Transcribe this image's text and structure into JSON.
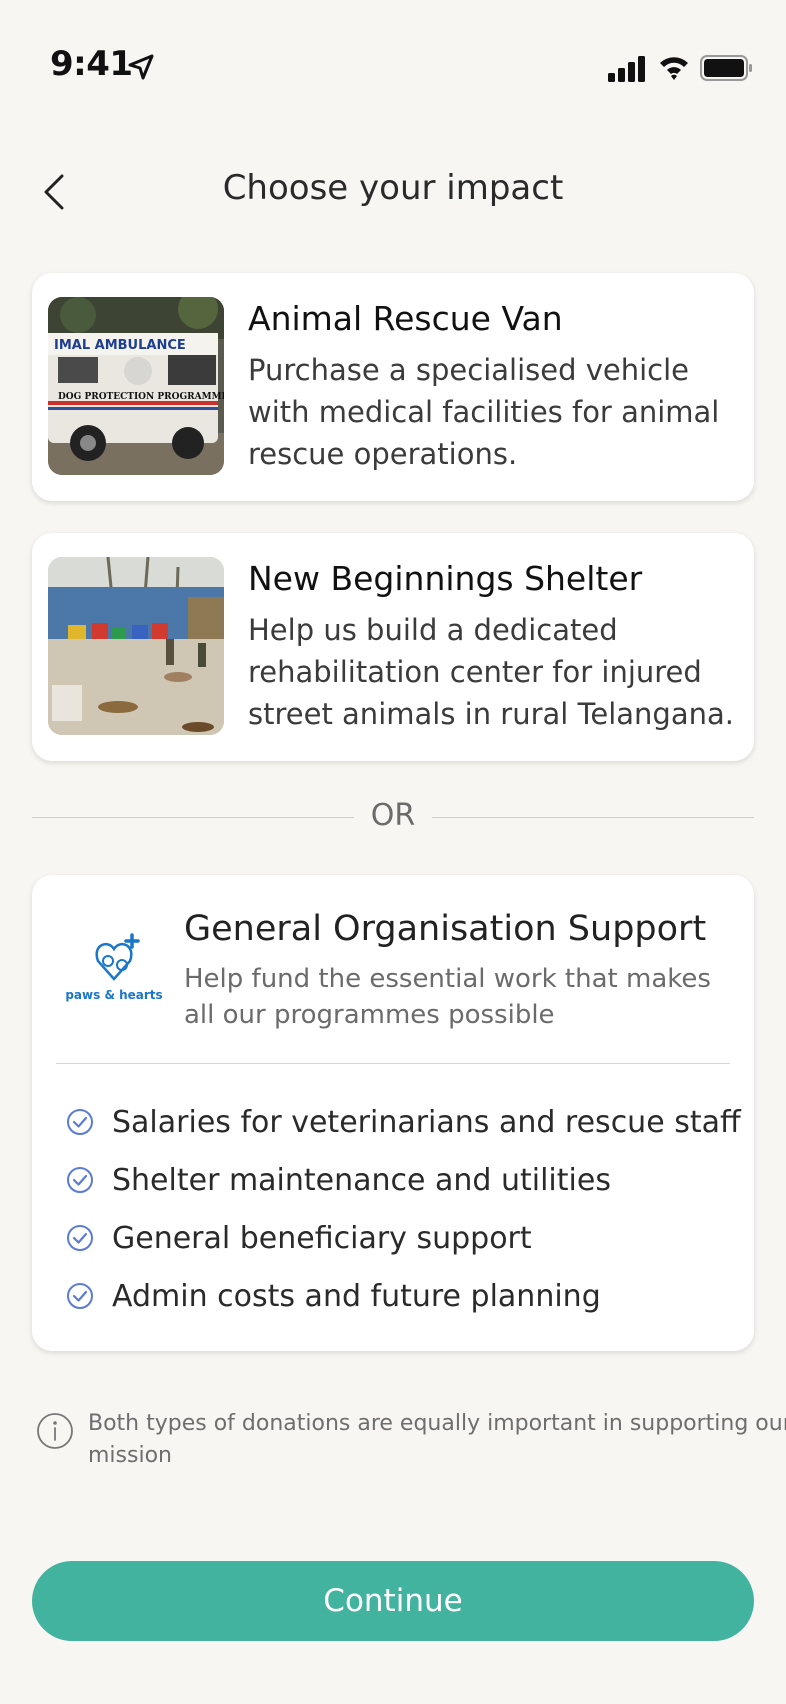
{
  "status_bar": {
    "time": "9:41"
  },
  "header": {
    "title": "Choose your impact"
  },
  "projects": [
    {
      "title": "Animal Rescue Van",
      "description": "Purchase a specialised vehicle with medical facilities for animal rescue operations.",
      "image_text_top": "IMAL AMBULANCE",
      "image_text_side": "DOG PROTECTION PROGRAMME"
    },
    {
      "title": "New Beginnings Shelter",
      "description": "Help us build a dedicated rehabilitation center for injured street animals in rural Telangana."
    }
  ],
  "divider": {
    "label": "OR"
  },
  "support": {
    "logo_text": "paws & hearts",
    "title": "General Organisation Support",
    "description": "Help fund the essential work that makes all our programmes possible",
    "benefits": [
      "Salaries for veterinarians and rescue staff",
      "Shelter maintenance and utilities",
      "General beneficiary support",
      "Admin costs and future planning"
    ]
  },
  "info_note": "Both types of donations are equally important in supporting our mission",
  "cta": {
    "label": "Continue"
  },
  "colors": {
    "accent": "#42b39f",
    "check": "#5b7bd6",
    "logo_blue": "#1a76c9",
    "background": "#f7f6f3"
  },
  "icons": [
    "location-arrow-icon",
    "signal-icon",
    "wifi-icon",
    "battery-icon",
    "chevron-left-icon",
    "check-circle-icon",
    "info-icon"
  ]
}
